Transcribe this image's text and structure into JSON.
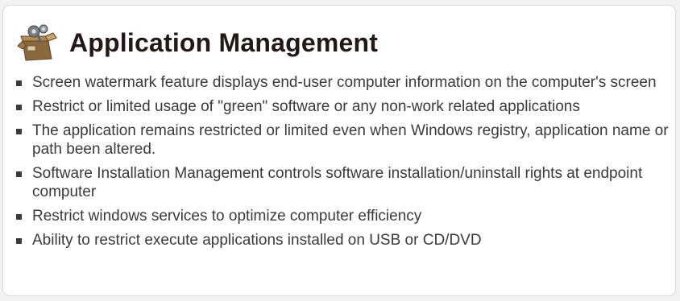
{
  "header": {
    "icon": "application-box-icon",
    "title": "Application Management"
  },
  "features": [
    {
      "text": "Screen watermark feature displays end-user computer information on the computer's screen"
    },
    {
      "text": "Restrict or limited usage of \"green\" software or any non-work related applications"
    },
    {
      "text": "The application remains restricted or limited even when Windows registry, application name or path been altered."
    },
    {
      "text": "Software Installation Management controls software installation/uninstall rights at endpoint computer"
    },
    {
      "text": "Restrict windows services to optimize computer efficiency"
    },
    {
      "text": "Ability to restrict execute applications installed on USB or CD/DVD"
    }
  ],
  "colors": {
    "title": "#231815",
    "text": "#3a3a3a",
    "panel_border": "#d9d9d9"
  }
}
